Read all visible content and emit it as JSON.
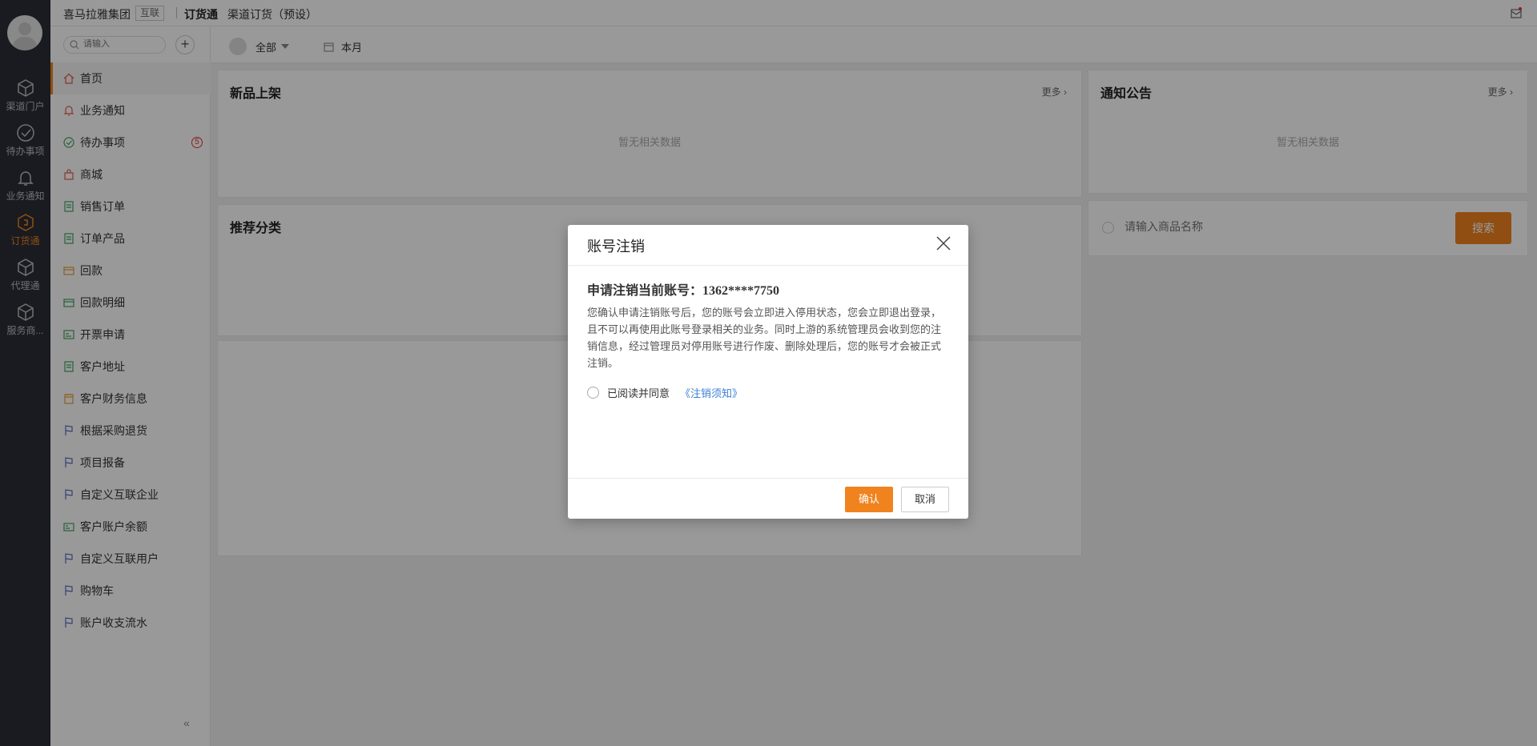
{
  "topbar": {
    "org": "喜马拉雅集团",
    "org_tag": "互联",
    "app": "订货通",
    "crumb": "渠道订货（预设）"
  },
  "rail": {
    "items": [
      {
        "label": "渠道门户",
        "icon": "cube-icon"
      },
      {
        "label": "待办事项",
        "icon": "check-circle-icon"
      },
      {
        "label": "业务通知",
        "icon": "bell-icon"
      },
      {
        "label": "订货通",
        "icon": "order-icon",
        "active": true
      },
      {
        "label": "代理通",
        "icon": "cube-icon"
      },
      {
        "label": "服务商...",
        "icon": "cube-icon"
      }
    ]
  },
  "sidebar": {
    "search_placeholder": "请输入",
    "add_label": "+",
    "collapse_label": "«",
    "items": [
      {
        "label": "首页",
        "icon": "home-icon",
        "active": true
      },
      {
        "label": "业务通知",
        "icon": "bell-icon"
      },
      {
        "label": "待办事项",
        "icon": "check-circle-icon",
        "badge": "5"
      },
      {
        "label": "商城",
        "icon": "bag-icon"
      },
      {
        "label": "销售订单",
        "icon": "doc-icon"
      },
      {
        "label": "订单产品",
        "icon": "doc-icon"
      },
      {
        "label": "回款",
        "icon": "card-icon"
      },
      {
        "label": "回款明细",
        "icon": "card-icon"
      },
      {
        "label": "开票申请",
        "icon": "invoice-icon"
      },
      {
        "label": "客户地址",
        "icon": "doc-icon"
      },
      {
        "label": "客户财务信息",
        "icon": "calendar-icon"
      },
      {
        "label": "根据采购退货",
        "icon": "flag-icon"
      },
      {
        "label": "项目报备",
        "icon": "flag-icon"
      },
      {
        "label": "自定义互联企业",
        "icon": "flag-icon"
      },
      {
        "label": "客户账户余额",
        "icon": "card-icon"
      },
      {
        "label": "自定义互联用户",
        "icon": "flag-icon"
      },
      {
        "label": "购物车",
        "icon": "flag-icon"
      },
      {
        "label": "账户收支流水",
        "icon": "flag-icon"
      }
    ]
  },
  "filter": {
    "scope": "全部",
    "period": "本月"
  },
  "panels": {
    "new_products": {
      "title": "新品上架",
      "more": "更多 ›",
      "empty": "暂无相关数据"
    },
    "notices": {
      "title": "通知公告",
      "more": "更多 ›",
      "empty": "暂无相关数据"
    },
    "categories": {
      "title": "推荐分类"
    },
    "product_search": {
      "placeholder": "请输入商品名称",
      "button": "搜索"
    }
  },
  "modal": {
    "title": "账号注销",
    "heading": "申请注销当前账号：1362****7750",
    "description": "您确认申请注销账号后，您的账号会立即进入停用状态，您会立即退出登录，且不可以再使用此账号登录相关的业务。同时上游的系统管理员会收到您的注销信息，经过管理员对停用账号进行作废、删除处理后，您的账号才会被正式注销。",
    "agree_text": "已阅读并同意",
    "agree_link": "《注销须知》",
    "ok": "确认",
    "cancel": "取消"
  },
  "colors": {
    "accent": "#f0831e",
    "rail_bg": "#2a2e36",
    "link": "#3a7fd5"
  }
}
